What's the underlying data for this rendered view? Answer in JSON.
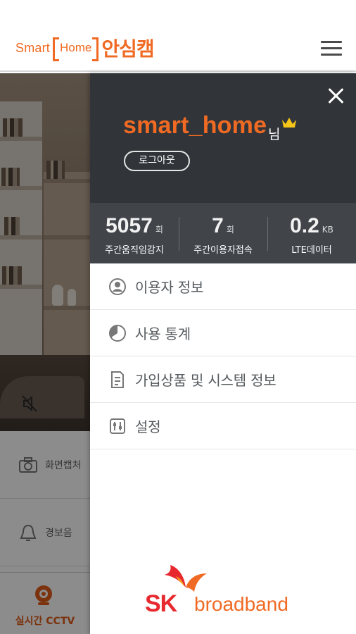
{
  "header": {
    "logo_smart": "Smart",
    "logo_home": "Home",
    "logo_kor": "안심캠",
    "menu_icon": "hamburger-icon"
  },
  "background": {
    "mute_icon": "speaker-mute-icon",
    "side_items": [
      {
        "label": "화면캡처",
        "icon": "camera-icon"
      },
      {
        "label": "경보음",
        "icon": "bell-icon"
      }
    ],
    "tab_cctv": {
      "label": "실시간 CCTV",
      "icon": "webcam-icon"
    }
  },
  "drawer": {
    "close_icon": "close-icon",
    "username": "smart_home",
    "honorific": "님",
    "crown_icon": "crown-icon",
    "logout_label": "로그아웃",
    "stats": [
      {
        "value": "5057",
        "unit": "회",
        "caption": "주간움직임감지"
      },
      {
        "value": "7",
        "unit": "회",
        "caption": "주간이용자접속"
      },
      {
        "value": "0.2",
        "unit": "KB",
        "caption": "LTE데이터"
      }
    ],
    "menu": [
      {
        "label": "이용자 정보",
        "icon": "user-icon"
      },
      {
        "label": "사용 통계",
        "icon": "pie-chart-icon"
      },
      {
        "label": "가입상품 및 시스템 정보",
        "icon": "document-icon"
      },
      {
        "label": "설정",
        "icon": "settings-icon"
      }
    ],
    "brand": {
      "sk": "SK",
      "broadband": "broadband"
    },
    "colors": {
      "accent": "#f06a23",
      "header_bg": "#313539",
      "stats_bg": "#41454a",
      "sk_red": "#e8282f"
    }
  }
}
